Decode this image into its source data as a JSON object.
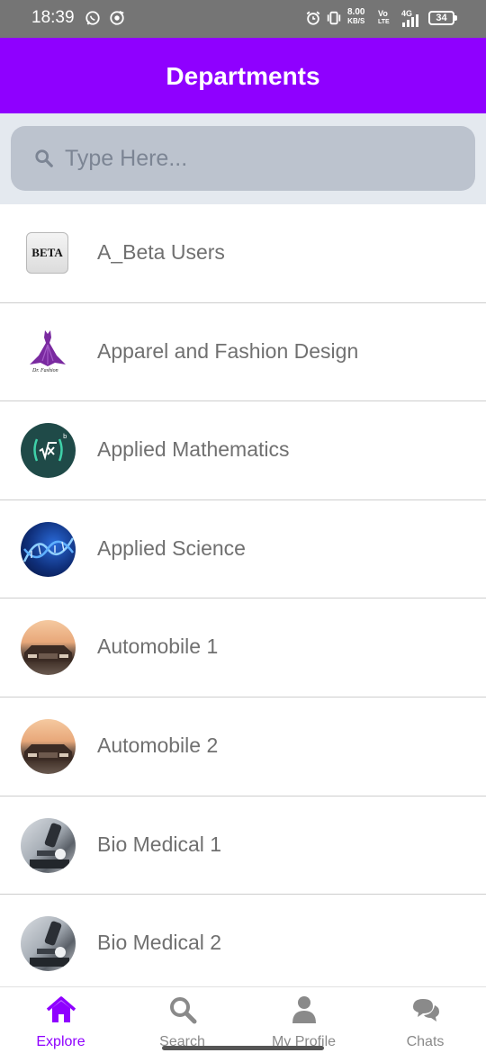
{
  "status_bar": {
    "time": "18:39",
    "net_speed_value": "8.00",
    "net_speed_unit": "KB/S",
    "volte_top": "Vo",
    "volte_bottom": "LTE",
    "signal_type": "4G",
    "battery": "34"
  },
  "header": {
    "title": "Departments"
  },
  "search": {
    "placeholder": "Type Here...",
    "value": ""
  },
  "departments": [
    {
      "name": "A_Beta Users",
      "avatar": "beta-badge",
      "avatar_text": "BETA"
    },
    {
      "name": "Apparel and Fashion Design",
      "avatar": "dress-logo",
      "avatar_text": "Dr. Fashion"
    },
    {
      "name": "Applied Mathematics",
      "avatar": "math-root-logo"
    },
    {
      "name": "Applied Science",
      "avatar": "dna-image"
    },
    {
      "name": "Automobile 1",
      "avatar": "car-image"
    },
    {
      "name": "Automobile 2",
      "avatar": "car-image"
    },
    {
      "name": "Bio Medical 1",
      "avatar": "microscope-image"
    },
    {
      "name": "Bio Medical 2",
      "avatar": "microscope-image"
    }
  ],
  "bottom_nav": [
    {
      "label": "Explore",
      "icon": "home-icon",
      "active": true
    },
    {
      "label": "Search",
      "icon": "search-icon",
      "active": false
    },
    {
      "label": "My Profile",
      "icon": "user-icon",
      "active": false
    },
    {
      "label": "Chats",
      "icon": "chat-icon",
      "active": false
    }
  ],
  "colors": {
    "primary": "#8f00ff",
    "status_bar": "#757575",
    "search_bg": "#bcc3ce",
    "text": "#707070"
  }
}
